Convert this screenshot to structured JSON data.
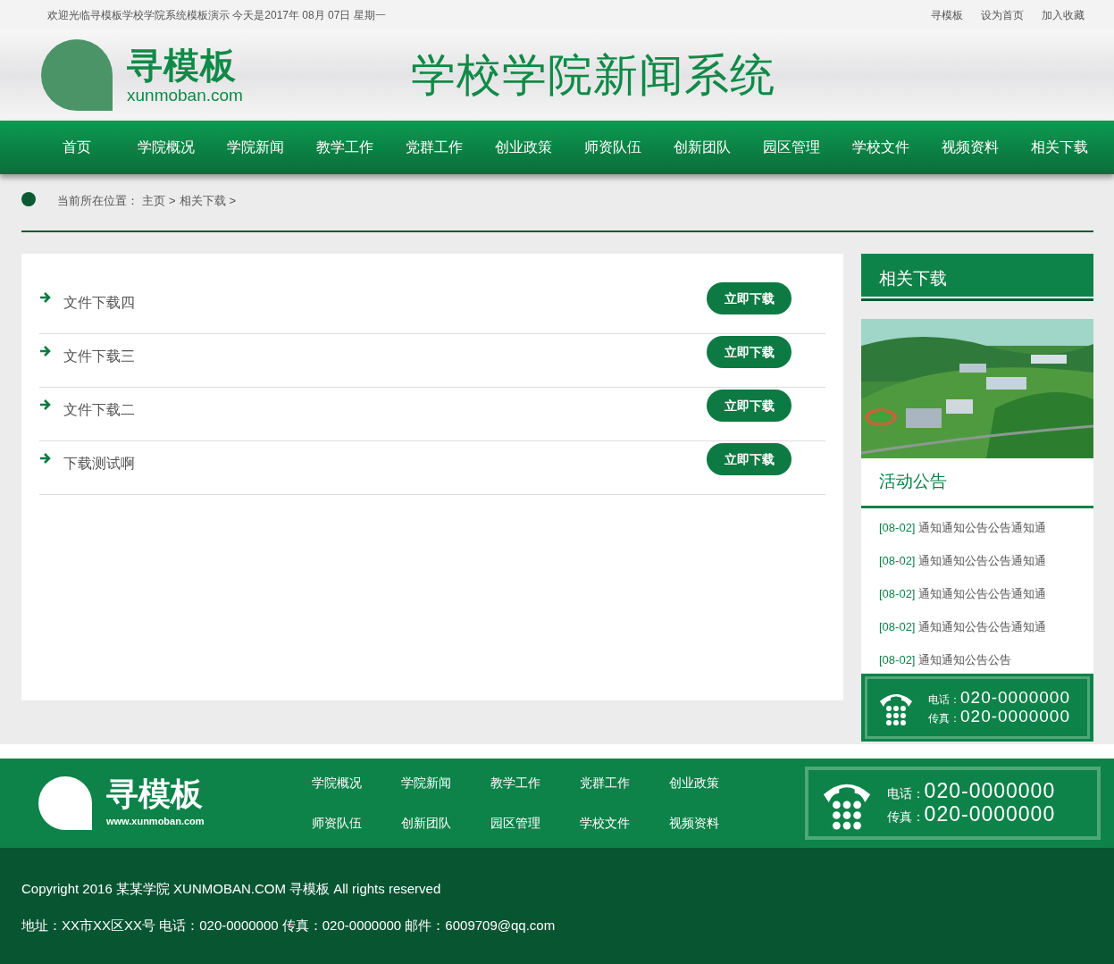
{
  "top_bar": {
    "welcome": "欢迎光临寻模板学校学院系统模板演示 今天是2017年 08月 07日 星期一",
    "links": [
      "寻模板",
      "设为首页",
      "加入收藏"
    ]
  },
  "header": {
    "logo": {
      "name": "寻模板",
      "url": "xunmoban.com"
    },
    "title": "学校学院新闻系统"
  },
  "nav": [
    "首页",
    "学院概况",
    "学院新闻",
    "教学工作",
    "党群工作",
    "创业政策",
    "师资队伍",
    "创新团队",
    "园区管理",
    "学校文件",
    "视频资料",
    "相关下载"
  ],
  "breadcrumb": {
    "label": "当前所在位置：",
    "items": [
      {
        "text": "主页",
        "sep": ">"
      },
      {
        "text": "相关下载",
        "sep": ">"
      }
    ]
  },
  "downloads": [
    {
      "title": "文件下载四",
      "button": "立即下载"
    },
    {
      "title": "文件下载三",
      "button": "立即下载"
    },
    {
      "title": "文件下载二",
      "button": "立即下载"
    },
    {
      "title": "下载测试啊",
      "button": "立即下载"
    }
  ],
  "sidebar": {
    "heading": "相关下载",
    "notice_heading": "活动公告",
    "notices": [
      {
        "date": "[08-02]",
        "title": "通知通知公告公告通知通"
      },
      {
        "date": "[08-02]",
        "title": "通知通知公告公告通知通"
      },
      {
        "date": "[08-02]",
        "title": "通知通知公告公告通知通"
      },
      {
        "date": "[08-02]",
        "title": "通知通知公告公告通知通"
      },
      {
        "date": "[08-02]",
        "title": "通知通知公告公告"
      }
    ],
    "contact": [
      {
        "label": "电话：",
        "number": "020-0000000"
      },
      {
        "label": "传真：",
        "number": "020-0000000"
      }
    ]
  },
  "footer": {
    "logo": {
      "name": "寻模板",
      "url": "www.xunmoban.com"
    },
    "links": [
      "学院概况",
      "学院新闻",
      "教学工作",
      "党群工作",
      "创业政策",
      "师资队伍",
      "创新团队",
      "园区管理",
      "学校文件",
      "视频资料"
    ],
    "contact": [
      {
        "label": "电话：",
        "number": "020-0000000"
      },
      {
        "label": "传真：",
        "number": "020-0000000"
      }
    ],
    "copyright": "Copyright 2016 某某学院 XUNMOBAN.COM 寻模板 All rights reserved",
    "address": "地址：XX市XX区XX号 电话：020-0000000 传真：020-0000000 邮件：6009709@qq.com"
  }
}
